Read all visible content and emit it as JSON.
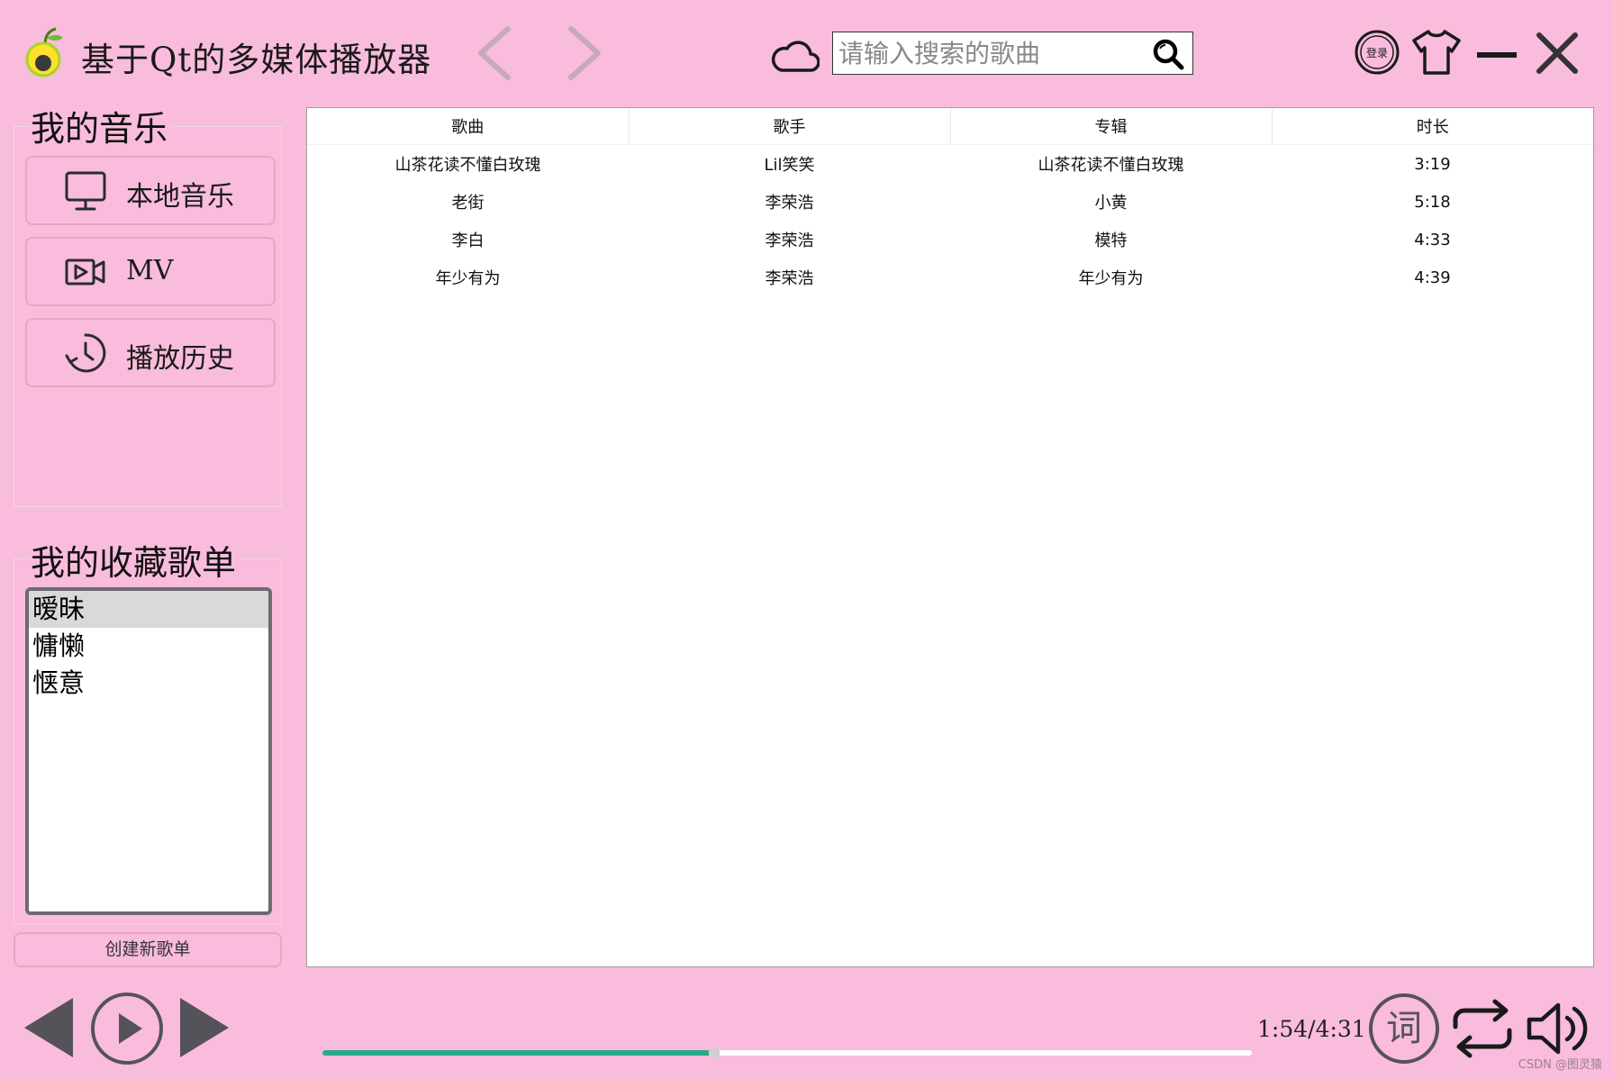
{
  "app": {
    "title": "基于Qt的多媒体播放器",
    "search_placeholder": "请输入搜索的歌曲",
    "login_label": "登录"
  },
  "sidebar": {
    "my_music_title": "我的音乐",
    "items": [
      {
        "label": "本地音乐",
        "icon": "monitor-icon"
      },
      {
        "label": "MV",
        "icon": "video-icon"
      },
      {
        "label": "播放历史",
        "icon": "history-icon"
      }
    ],
    "favorites_title": "我的收藏歌单",
    "favorites": [
      "暧昧",
      "慵懒",
      "惬意"
    ],
    "favorites_selected": "暧昧",
    "new_playlist_label": "创建新歌单"
  },
  "table": {
    "columns": [
      "歌曲",
      "歌手",
      "专辑",
      "时长"
    ],
    "rows": [
      [
        "山茶花读不懂白玫瑰",
        "Lil笑笑",
        "山茶花读不懂白玫瑰",
        "3:19"
      ],
      [
        "老街",
        "李荣浩",
        "小黄",
        "5:18"
      ],
      [
        "李白",
        "李荣浩",
        "模特",
        "4:33"
      ],
      [
        "年少有为",
        "李荣浩",
        "年少有为",
        "4:39"
      ]
    ]
  },
  "player": {
    "time_display": "1:54/4:31",
    "progress_fraction": 0.42,
    "lyric_label": "词"
  },
  "watermark": "CSDN @图灵猿",
  "colors": {
    "background": "#f9bcdc",
    "progress": "#2aa88a",
    "button_border": "#e9a5c4"
  }
}
